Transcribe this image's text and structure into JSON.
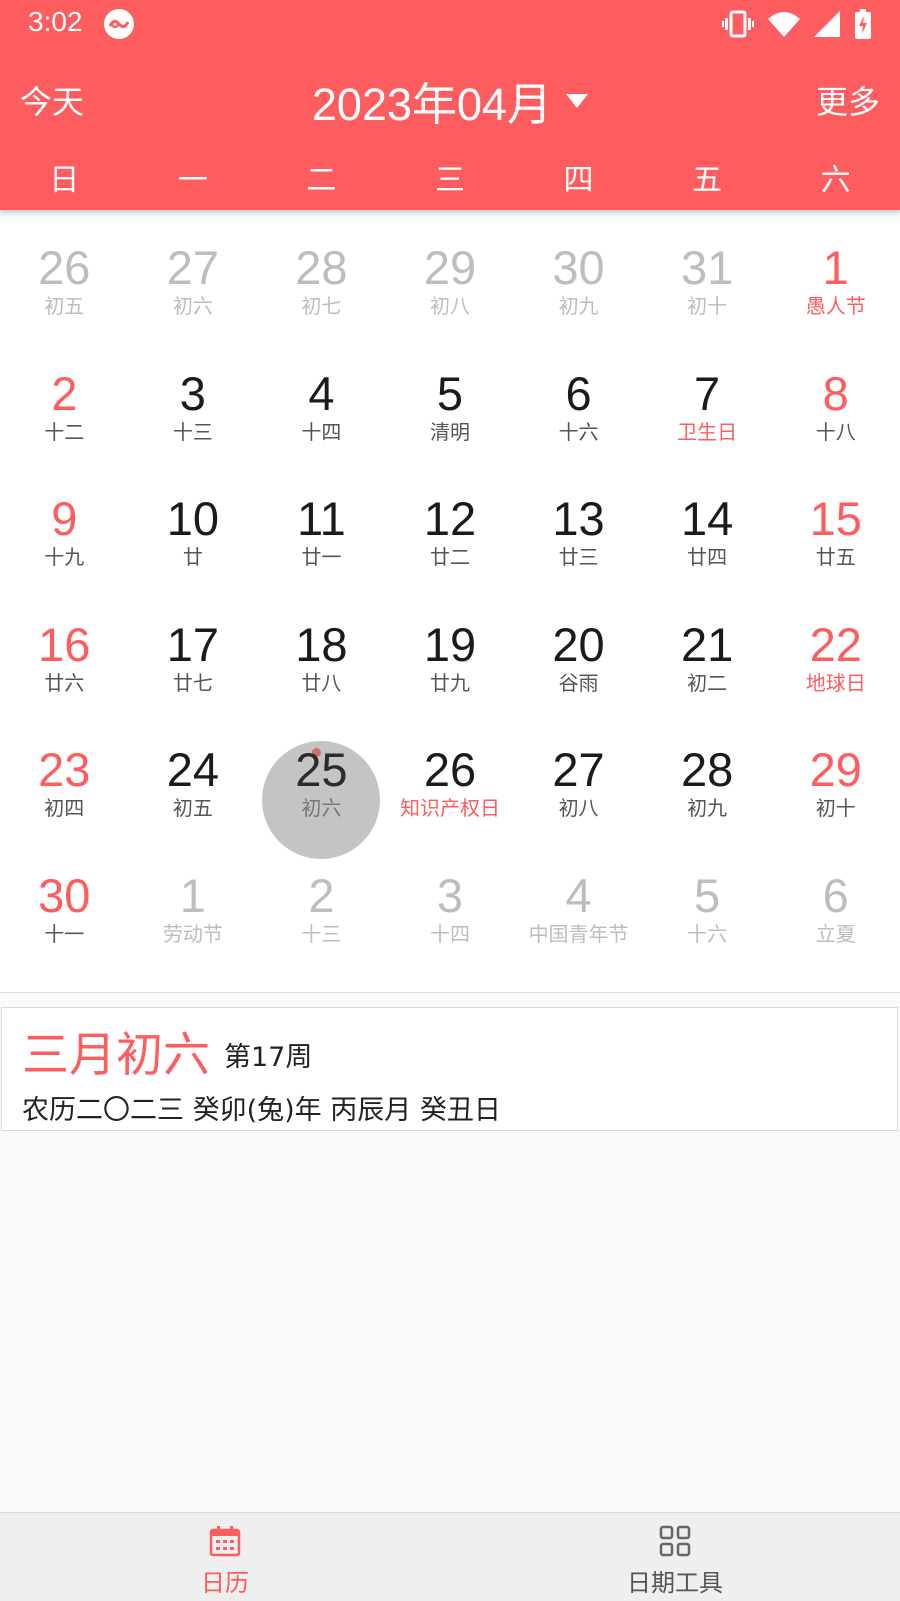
{
  "status_bar": {
    "time": "3:02",
    "icons": [
      "app-notification-icon",
      "vibrate-icon",
      "wifi-icon",
      "signal-icon",
      "battery-charging-icon"
    ]
  },
  "toolbar": {
    "today_label": "今天",
    "title": "2023年04月",
    "more_label": "更多",
    "dropdown_icon": "triangle-down-icon"
  },
  "weekdays": [
    "日",
    "一",
    "二",
    "三",
    "四",
    "五",
    "六"
  ],
  "calendar": {
    "rows": [
      [
        {
          "day": "26",
          "sub": "初五",
          "style": "outside"
        },
        {
          "day": "27",
          "sub": "初六",
          "style": "outside"
        },
        {
          "day": "28",
          "sub": "初七",
          "style": "outside"
        },
        {
          "day": "29",
          "sub": "初八",
          "style": "outside"
        },
        {
          "day": "30",
          "sub": "初九",
          "style": "outside"
        },
        {
          "day": "31",
          "sub": "初十",
          "style": "outside"
        },
        {
          "day": "1",
          "sub": "愚人节",
          "style": "outside-red"
        }
      ],
      [
        {
          "day": "2",
          "sub": "十二",
          "style": "weekend"
        },
        {
          "day": "3",
          "sub": "十三",
          "style": "normal"
        },
        {
          "day": "4",
          "sub": "十四",
          "style": "normal"
        },
        {
          "day": "5",
          "sub": "清明",
          "style": "normal"
        },
        {
          "day": "6",
          "sub": "十六",
          "style": "normal"
        },
        {
          "day": "7",
          "sub": "卫生日",
          "style": "normal",
          "festival": true
        },
        {
          "day": "8",
          "sub": "十八",
          "style": "weekend"
        }
      ],
      [
        {
          "day": "9",
          "sub": "十九",
          "style": "weekend"
        },
        {
          "day": "10",
          "sub": "廿",
          "style": "normal"
        },
        {
          "day": "11",
          "sub": "廿一",
          "style": "normal"
        },
        {
          "day": "12",
          "sub": "廿二",
          "style": "normal"
        },
        {
          "day": "13",
          "sub": "廿三",
          "style": "normal"
        },
        {
          "day": "14",
          "sub": "廿四",
          "style": "normal"
        },
        {
          "day": "15",
          "sub": "廿五",
          "style": "weekend"
        }
      ],
      [
        {
          "day": "16",
          "sub": "廿六",
          "style": "weekend"
        },
        {
          "day": "17",
          "sub": "廿七",
          "style": "normal"
        },
        {
          "day": "18",
          "sub": "廿八",
          "style": "normal"
        },
        {
          "day": "19",
          "sub": "廿九",
          "style": "normal"
        },
        {
          "day": "20",
          "sub": "谷雨",
          "style": "normal"
        },
        {
          "day": "21",
          "sub": "初二",
          "style": "normal"
        },
        {
          "day": "22",
          "sub": "地球日",
          "style": "weekend",
          "festival": true
        }
      ],
      [
        {
          "day": "23",
          "sub": "初四",
          "style": "weekend"
        },
        {
          "day": "24",
          "sub": "初五",
          "style": "normal"
        },
        {
          "day": "25",
          "sub": "初六",
          "style": "selected",
          "has_event": true
        },
        {
          "day": "26",
          "sub": "知识产权日",
          "style": "normal",
          "festival": true
        },
        {
          "day": "27",
          "sub": "初八",
          "style": "normal"
        },
        {
          "day": "28",
          "sub": "初九",
          "style": "normal"
        },
        {
          "day": "29",
          "sub": "初十",
          "style": "weekend"
        }
      ],
      [
        {
          "day": "30",
          "sub": "十一",
          "style": "weekend"
        },
        {
          "day": "1",
          "sub": "劳动节",
          "style": "outside"
        },
        {
          "day": "2",
          "sub": "十三",
          "style": "outside"
        },
        {
          "day": "3",
          "sub": "十四",
          "style": "outside"
        },
        {
          "day": "4",
          "sub": "中国青年节",
          "style": "outside"
        },
        {
          "day": "5",
          "sub": "十六",
          "style": "outside"
        },
        {
          "day": "6",
          "sub": "立夏",
          "style": "outside"
        }
      ]
    ]
  },
  "info": {
    "lunar_date": "三月初六",
    "week": "第17周",
    "detail": "农历二〇二三 癸卯(兔)年 丙辰月 癸丑日"
  },
  "bottom_nav": [
    {
      "label": "日历",
      "icon": "calendar-icon",
      "active": true
    },
    {
      "label": "日期工具",
      "icon": "grid-apps-icon",
      "active": false
    }
  ],
  "colors": {
    "accent": "#fe5d5f",
    "selected_circle": "#c4c4c4",
    "outside_month": "#bdbdbd"
  }
}
